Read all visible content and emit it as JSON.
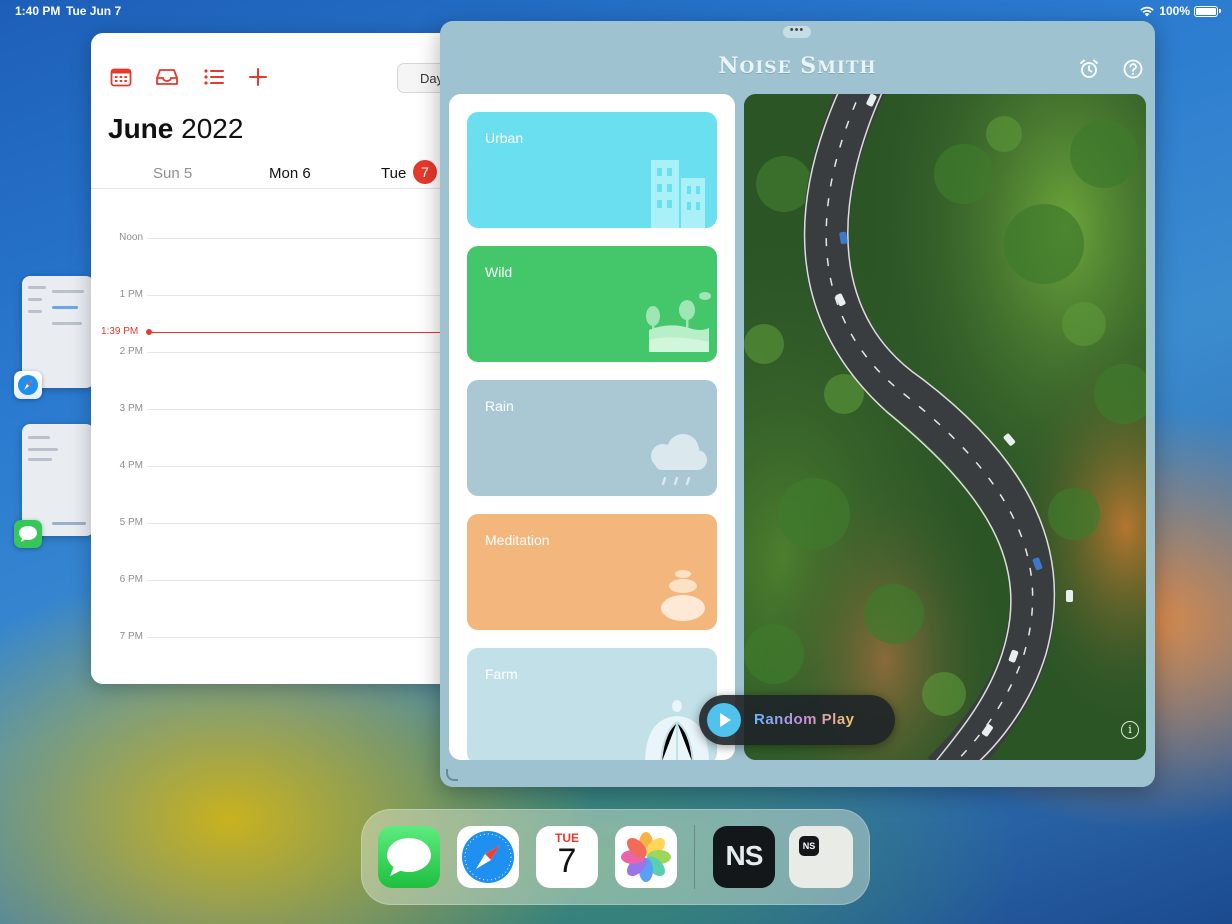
{
  "status_bar": {
    "time": "1:40 PM",
    "date": "Tue Jun 7",
    "battery": "100%"
  },
  "calendar": {
    "view_button": "Day",
    "month": "June",
    "year": "2022",
    "days": [
      {
        "label": "Sun 5"
      },
      {
        "label": "Mon 6"
      },
      {
        "label": "Tue"
      }
    ],
    "today_badge": "7",
    "hours": [
      "Noon",
      "1 PM",
      "2 PM",
      "3 PM",
      "4 PM",
      "5 PM",
      "6 PM",
      "7 PM"
    ],
    "current_time": "1:39 PM",
    "accent": "#e7392b"
  },
  "noise_smith": {
    "title_first": "N",
    "title_first_rest": "OISE",
    "title_second": "S",
    "title_second_rest": "MITH",
    "categories": [
      {
        "label": "Urban",
        "color": "#6adff0"
      },
      {
        "label": "Wild",
        "color": "#44c66a"
      },
      {
        "label": "Rain",
        "color": "#a9c8d4"
      },
      {
        "label": "Meditation",
        "color": "#f3b67c"
      },
      {
        "label": "Farm",
        "color": "#c2e0e8"
      }
    ],
    "random_play_label": "Random Play",
    "info_label": "i"
  },
  "dock": {
    "calendar_month": "TUE",
    "calendar_day": "7",
    "noise_smith_label": "NS",
    "recent_label": "NS"
  }
}
